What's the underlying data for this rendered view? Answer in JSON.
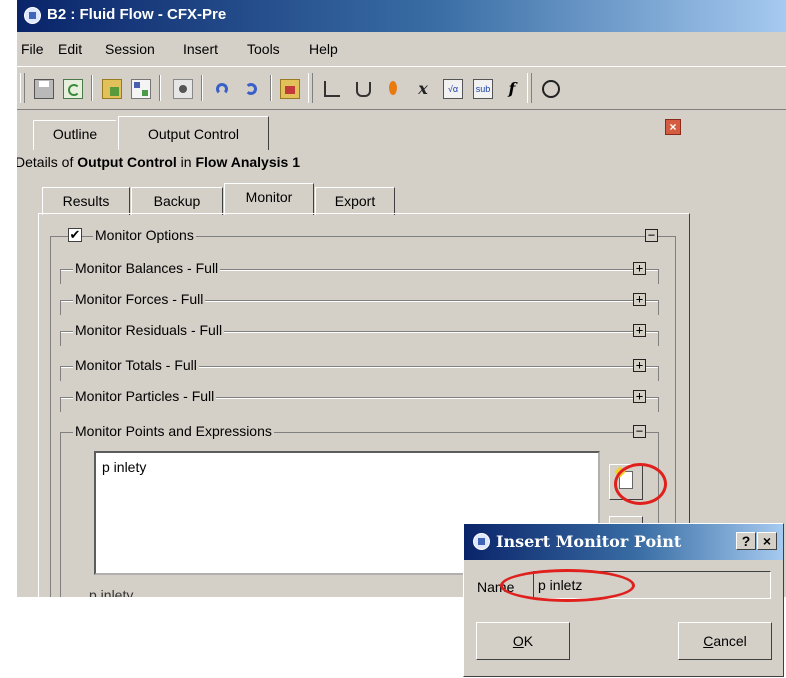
{
  "window": {
    "title": "B2 : Fluid Flow - CFX-Pre"
  },
  "menu": [
    "File",
    "Edit",
    "Session",
    "Insert",
    "Tools",
    "Help"
  ],
  "toolbar": {
    "icons": [
      "save",
      "refresh",
      "open",
      "network",
      "camera",
      "undo",
      "redo",
      "domain",
      "boundary",
      "subdomain",
      "material",
      "expression",
      "calculator",
      "user-function",
      "function",
      "clock"
    ],
    "glyph_expression": "x",
    "glyph_function": "f",
    "box_calc": "√α",
    "box_sub": "sub"
  },
  "tabs": {
    "outline": "Outline",
    "output_control": "Output Control"
  },
  "details": {
    "prefix": "Details of ",
    "object": "Output Control",
    "mid": " in ",
    "analysis": "Flow Analysis 1"
  },
  "subtabs": {
    "results": "Results",
    "backup": "Backup",
    "monitor": "Monitor",
    "export": "Export"
  },
  "monitor_options": {
    "label": "Monitor Options",
    "checked": true,
    "check_glyph": "✔"
  },
  "groups": [
    {
      "label": "Monitor Balances - Full",
      "toggle": "+"
    },
    {
      "label": "Monitor Forces - Full",
      "toggle": "+"
    },
    {
      "label": "Monitor Residuals - Full",
      "toggle": "+"
    },
    {
      "label": "Monitor Totals - Full",
      "toggle": "+"
    },
    {
      "label": "Monitor Particles - Full",
      "toggle": "+"
    },
    {
      "label": "Monitor Points and Expressions",
      "toggle": "−"
    }
  ],
  "monitor_options_toggle": "−",
  "points_list": [
    "p inlety"
  ],
  "partial_label": "p inlety",
  "dialog": {
    "title": "Insert Monitor Point",
    "help": "?",
    "close": "×",
    "name_label_pre": "Na",
    "name_label_m": "m",
    "name_label_post": "e",
    "name_value": "p inletz",
    "ok_u": "O",
    "ok_rest": "K",
    "cancel_u": "C",
    "cancel_rest": "ancel"
  },
  "highlight_color": "#e0201c",
  "title_gradient": [
    "#0a246a",
    "#a6caf0"
  ]
}
